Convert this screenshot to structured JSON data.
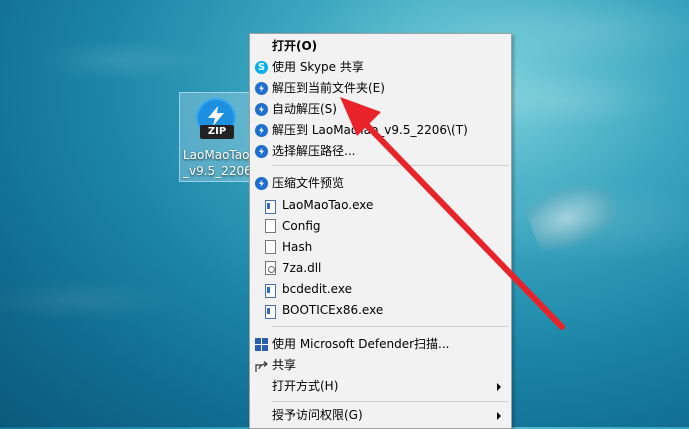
{
  "desktop": {
    "icon_label_line1": "LaoMaoTao",
    "icon_label_line2": "_v9.5_2206",
    "zip_badge": "ZIP"
  },
  "menu": {
    "items": [
      {
        "label": "打开(O)",
        "icon": "none"
      },
      {
        "label": "使用 Skype 共享",
        "icon": "skype-icon"
      },
      {
        "label": "解压到当前文件夹(E)",
        "icon": "extract-icon"
      },
      {
        "label": "自动解压(S)",
        "icon": "extract-icon"
      },
      {
        "label": "解压到 LaoMaoTao_v9.5_2206\\(T)",
        "icon": "extract-icon"
      },
      {
        "label": "选择解压路径...",
        "icon": "extract-icon"
      },
      {
        "label": "压缩文件预览",
        "icon": "extract-icon"
      },
      {
        "label": "LaoMaoTao.exe",
        "icon": "exe-file-icon"
      },
      {
        "label": "Config",
        "icon": "file-icon"
      },
      {
        "label": "Hash",
        "icon": "file-icon"
      },
      {
        "label": "7za.dll",
        "icon": "dll-file-icon"
      },
      {
        "label": "bcdedit.exe",
        "icon": "exe-file-icon"
      },
      {
        "label": "BOOTICEx86.exe",
        "icon": "exe-file-icon"
      },
      {
        "label": "使用 Microsoft Defender扫描...",
        "icon": "defender-icon"
      },
      {
        "label": "共享",
        "icon": "share-icon"
      },
      {
        "label": "打开方式(H)",
        "icon": "none"
      },
      {
        "label": "授予访问权限(G)",
        "icon": "none"
      }
    ]
  },
  "colors": {
    "menu_bg": "#f2f2f2",
    "accent_blue": "#1f6fd1",
    "arrow_red": "#e8232a"
  }
}
